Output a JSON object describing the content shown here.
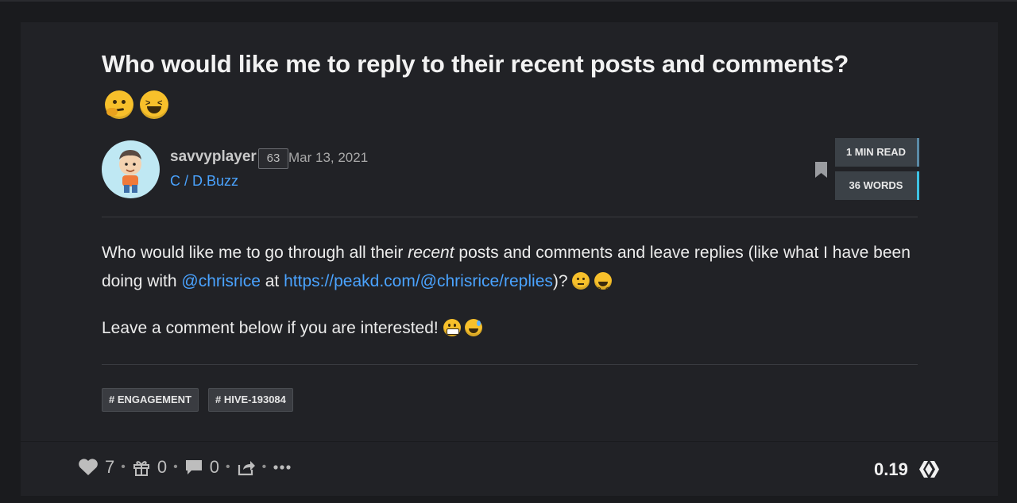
{
  "post": {
    "title": "Who would like me to reply to their recent posts and comments?",
    "author": "savvyplayer",
    "reputation": "63",
    "date": "Mar 13, 2021",
    "community": "C / D.Buzz",
    "read_time": "1 MIN READ",
    "word_count": "36 WORDS",
    "body": {
      "p1_before": "Who would like me to go through all their ",
      "p1_em": "recent",
      "p1_mid": " posts and comments and leave replies (like what I have been doing with ",
      "p1_mention": "@chrisrice",
      "p1_at": " at ",
      "p1_link": "https://peakd.com/@chrisrice/replies",
      "p1_end": ")?",
      "p2": "Leave a comment below if you are interested!"
    },
    "tags": [
      "# ENGAGEMENT",
      "# HIVE-193084"
    ]
  },
  "footer": {
    "votes": "7",
    "tips": "0",
    "comments": "0",
    "payout": "0.19"
  },
  "colors": {
    "background": "#1a1b1e",
    "card": "#212226",
    "link": "#4aa3ff",
    "stat_box": "#3b4147"
  },
  "icons": [
    "thinking-emoji-icon",
    "squinting-laugh-emoji-icon",
    "grinning-emoji-icon",
    "sweat-smile-emoji-icon",
    "bookmark-icon",
    "heart-icon",
    "gift-icon",
    "comment-icon",
    "share-icon",
    "more-icon",
    "hive-logo-icon"
  ]
}
